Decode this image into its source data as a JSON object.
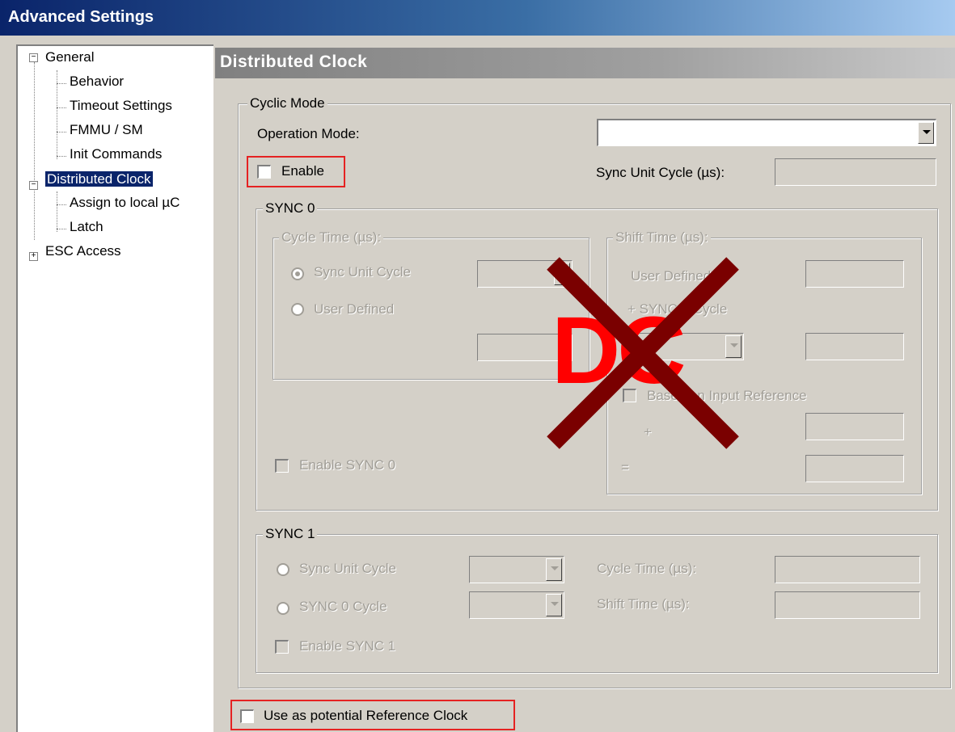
{
  "window": {
    "title": "Advanced Settings"
  },
  "tree": {
    "items": [
      {
        "label": "General"
      },
      {
        "label": "Behavior"
      },
      {
        "label": "Timeout Settings"
      },
      {
        "label": "FMMU / SM"
      },
      {
        "label": "Init Commands"
      },
      {
        "label": "Distributed Clock"
      },
      {
        "label": "Assign to local µC"
      },
      {
        "label": "Latch"
      },
      {
        "label": "ESC Access"
      }
    ]
  },
  "panel": {
    "header": "Distributed Clock",
    "cyclic_mode": {
      "title": "Cyclic Mode",
      "operation_mode_label": "Operation Mode:",
      "operation_mode_value": "",
      "enable_label": "Enable",
      "enable_checked": false,
      "sync_unit_cycle_label": "Sync Unit Cycle (µs):",
      "sync_unit_cycle_value": ""
    },
    "sync0": {
      "title": "SYNC 0",
      "cycle_time_title": "Cycle Time (µs):",
      "sync_unit_cycle_label": "Sync Unit Cycle",
      "user_defined_label": "User Defined",
      "shift_time_title": "Shift Time (µs):",
      "shift_user_defined_label": "User Defined",
      "plus_sync1_cycle_label": "+ SYNC 1 Cycle",
      "based_on_input_ref_label": "Based on Input Reference",
      "plus_label": "+",
      "equals_label": "=",
      "enable_sync0_label": "Enable SYNC 0"
    },
    "sync1": {
      "title": "SYNC 1",
      "sync_unit_cycle_label": "Sync Unit Cycle",
      "sync0_cycle_label": "SYNC 0 Cycle",
      "cycle_time_label": "Cycle Time (µs):",
      "shift_time_label": "Shift Time (µs):",
      "enable_sync1_label": "Enable SYNC 1"
    },
    "reference_clock_label": "Use as potential Reference Clock",
    "reference_clock_checked": false
  },
  "overlay": {
    "text": "DC",
    "text_color": "#ff0000",
    "cross_color": "#7a0000"
  },
  "colors": {
    "highlight_box": "#e52222",
    "selection": "#0a246a"
  }
}
